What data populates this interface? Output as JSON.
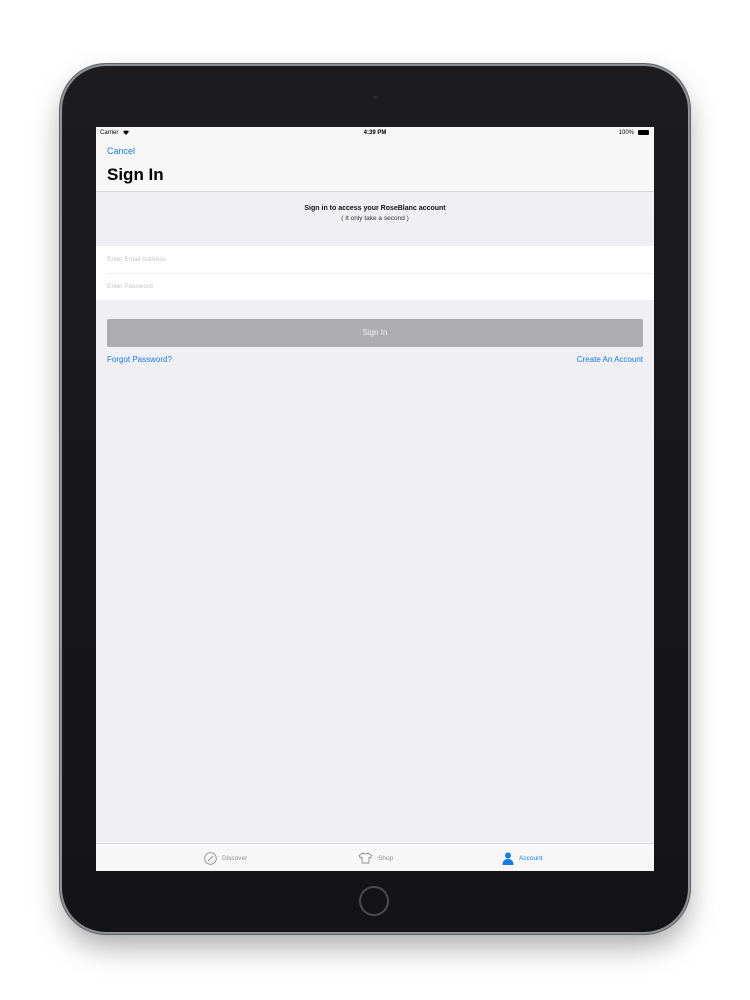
{
  "status_bar": {
    "carrier": "Carrier",
    "time": "4:39 PM",
    "battery": "100%"
  },
  "nav": {
    "cancel_label": "Cancel",
    "title": "Sign In"
  },
  "intro": {
    "headline": "Sign in to access your RoseBlanc account",
    "subline": "( It only take a second )"
  },
  "form": {
    "email_placeholder": "Enter Email Address",
    "email_value": "",
    "password_placeholder": "Enter Password",
    "password_value": "",
    "sign_in_label": "Sign In",
    "forgot_label": "Forgot Password?",
    "create_label": "Create An Account"
  },
  "tabs": [
    {
      "label": "Discover",
      "icon": "compass-icon",
      "selected": false
    },
    {
      "label": "Shop",
      "icon": "shirt-icon",
      "selected": false
    },
    {
      "label": "Account",
      "icon": "person-icon",
      "selected": true
    }
  ],
  "colors": {
    "accent": "#1a7ee0",
    "button_disabled": "#adadb0",
    "screen_background": "#efeff4"
  }
}
